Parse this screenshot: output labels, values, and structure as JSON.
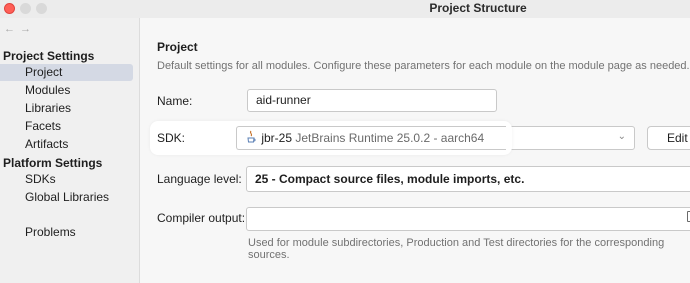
{
  "window": {
    "title": "Project Structure"
  },
  "nav": {
    "back": "←",
    "forward": "→"
  },
  "sidebar": {
    "project_settings_header": "Project Settings",
    "project_settings_items": [
      {
        "label": "Project",
        "selected": true
      },
      {
        "label": "Modules"
      },
      {
        "label": "Libraries"
      },
      {
        "label": "Facets"
      },
      {
        "label": "Artifacts"
      }
    ],
    "platform_settings_header": "Platform Settings",
    "platform_settings_items": [
      {
        "label": "SDKs"
      },
      {
        "label": "Global Libraries"
      }
    ],
    "problems_label": "Problems"
  },
  "main": {
    "section_title": "Project",
    "section_description": "Default settings for all modules. Configure these parameters for each module on the module page as needed.",
    "name": {
      "label": "Name:",
      "value": "aid-runner"
    },
    "sdk": {
      "label": "SDK:",
      "name": "jbr-25",
      "description": "JetBrains Runtime 25.0.2 - aarch64",
      "icon": "java-icon",
      "edit_label": "Edit"
    },
    "language_level": {
      "label": "Language level:",
      "value": "25 - Compact source files, module imports, etc."
    },
    "compiler_output": {
      "label": "Compiler output:",
      "value": "",
      "hint": "Used for module subdirectories, Production and Test directories for the corresponding sources."
    }
  },
  "colors": {
    "selection": "#d4d9e4",
    "close_button": "#ff5f57",
    "sdk_highlight": "#ffffff"
  }
}
